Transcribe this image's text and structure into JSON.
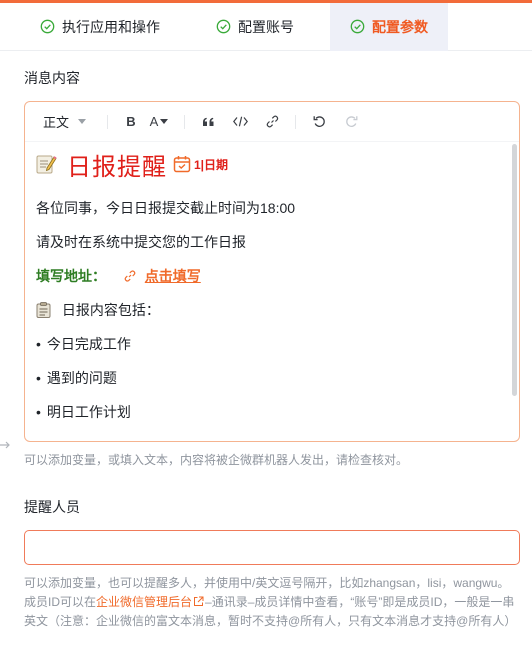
{
  "tabs": [
    {
      "label": "执行应用和操作",
      "icon": "check-circle-icon",
      "active": false
    },
    {
      "label": "配置账号",
      "icon": "check-circle-icon",
      "active": false
    },
    {
      "label": "配置参数",
      "icon": "check-circle-icon",
      "active": true
    }
  ],
  "message": {
    "label": "消息内容",
    "toolbar": {
      "paragraph_style": "正文",
      "buttons": [
        "bold-icon",
        "font-color-icon",
        "quote-icon",
        "code-icon",
        "link-icon",
        "undo-icon",
        "redo-icon"
      ],
      "bold_glyph": "B",
      "font_color_glyph": "A"
    },
    "content": {
      "heading_emoji": "memo-icon",
      "heading": "日报提醒",
      "heading_date": "1|日期",
      "line1": "各位同事，今日日报提交截止时间为18:00",
      "line2": "请及时在系统中提交您的工作日报",
      "address_label": "填写地址：",
      "address_link": "点击填写",
      "list_intro": "日报内容包括：",
      "items": [
        "今日完成工作",
        "遇到的问题",
        "明日工作计划"
      ]
    },
    "help": "可以添加变量，或填入文本，内容将被企微群机器人发出，请检查核对。"
  },
  "reminder": {
    "label": "提醒人员",
    "value": "",
    "help_part1": "可以添加变量，也可以提醒多人，并使用中/英文逗号隔开，比如zhangsan，lisi，wangwu。",
    "help_part2_prefix": "成员ID可以在",
    "help_link": "企业微信管理后台",
    "help_part2_suffix": "–通讯录–成员详情中查看，“账号”即是成员ID，一般是一串",
    "help_part3": "英文（注意：企业微信的富文本消息，暂时不支持@所有人，只有文本消息才支持@所有人）"
  },
  "colors": {
    "accent": "#f05a22",
    "active_tab_bg": "#eef0f8",
    "heading_red": "#e0201a",
    "address_green": "#2e7d23",
    "check_green": "#3aaa3a"
  }
}
